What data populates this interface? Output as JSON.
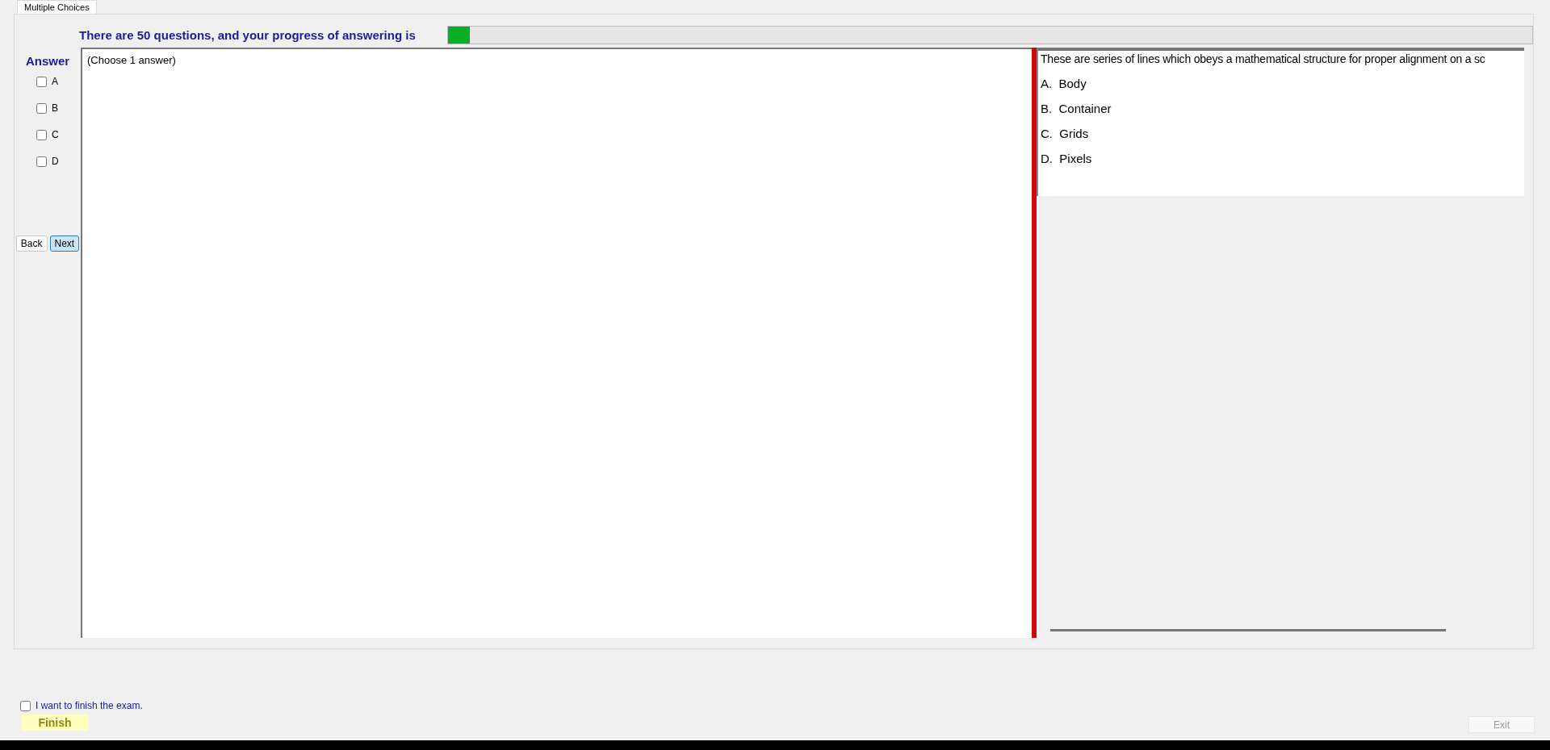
{
  "tabs": [
    {
      "label": "Multiple Choices",
      "selected": true
    }
  ],
  "progress": {
    "label": "There are 50 questions, and your progress of answering is",
    "level": 0.02
  },
  "answer": {
    "label": "Answer",
    "options": [
      {
        "label": "A",
        "checked": false
      },
      {
        "label": "B",
        "checked": false
      },
      {
        "label": "C",
        "checked": false
      },
      {
        "label": "D",
        "checked": false
      }
    ]
  },
  "nav_buttons": [
    {
      "label": "Back",
      "focused": false
    },
    {
      "label": "Next",
      "focused": true
    }
  ],
  "question": {
    "instruction": "(Choose 1 answer)",
    "text": "These are series of lines which obeys a mathematical structure for proper alignment on a sc",
    "choices": [
      "A.  Body",
      "B.  Container",
      "C.  Grids",
      "D.  Pixels"
    ]
  },
  "finish": {
    "confirm": {
      "label": "I want to finish the exam.",
      "checked": false
    },
    "button": {
      "label": "Finish",
      "disabled": false
    }
  },
  "exit_button": {
    "label": "Exit",
    "disabled": true
  }
}
